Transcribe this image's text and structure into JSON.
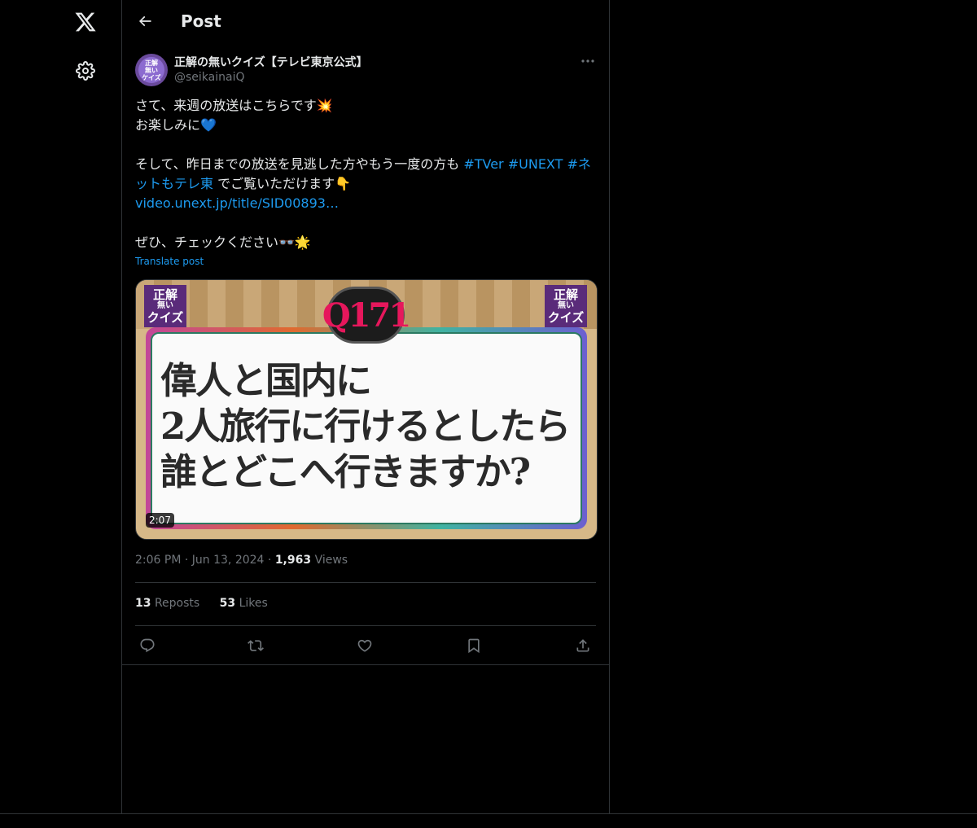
{
  "nav": {
    "logo_icon": "x-logo-icon",
    "settings_icon": "gear-icon"
  },
  "header": {
    "title": "Post",
    "back_icon": "arrow-left-icon"
  },
  "post": {
    "display_name": "正解の無いクイズ【テレビ東京公式】",
    "handle": "@seikainaiQ",
    "avatar_text": [
      "正解",
      "無い",
      "ケイズ"
    ],
    "body_lines": {
      "line1": "さて、来週の放送はこちらです💥",
      "line2": "お楽しみに💙",
      "line3_text": "そして、昨日までの放送を見逃した方やもう一度の方も ",
      "hashtag1": "#TVer",
      "hashtag2": "#UNEXT",
      "hashtag3": "#ネットもテレ東",
      "line3_end": " でご覧いただけます👇",
      "url": "video.unext.jp/title/SID00893…",
      "line5": "ぜひ、チェックください👓🌟"
    },
    "translate_label": "Translate post",
    "media": {
      "question_number": "Q171",
      "question_text": [
        "偉人と国内に",
        "2人旅行に行けるとしたら",
        "誰とどこへ行きますか?"
      ],
      "logo_left": [
        "正解",
        "無い",
        "クイズ"
      ],
      "logo_right": [
        "正解",
        "無い",
        "クイズ"
      ],
      "duration": "2:07"
    },
    "time": "2:06 PM",
    "date": "Jun 13, 2024",
    "views_count": "1,963",
    "views_label": "Views",
    "reposts_count": "13",
    "reposts_label": "Reposts",
    "likes_count": "53",
    "likes_label": "Likes",
    "actions": [
      "reply-icon",
      "repost-icon",
      "like-icon",
      "bookmark-icon",
      "share-icon"
    ]
  }
}
